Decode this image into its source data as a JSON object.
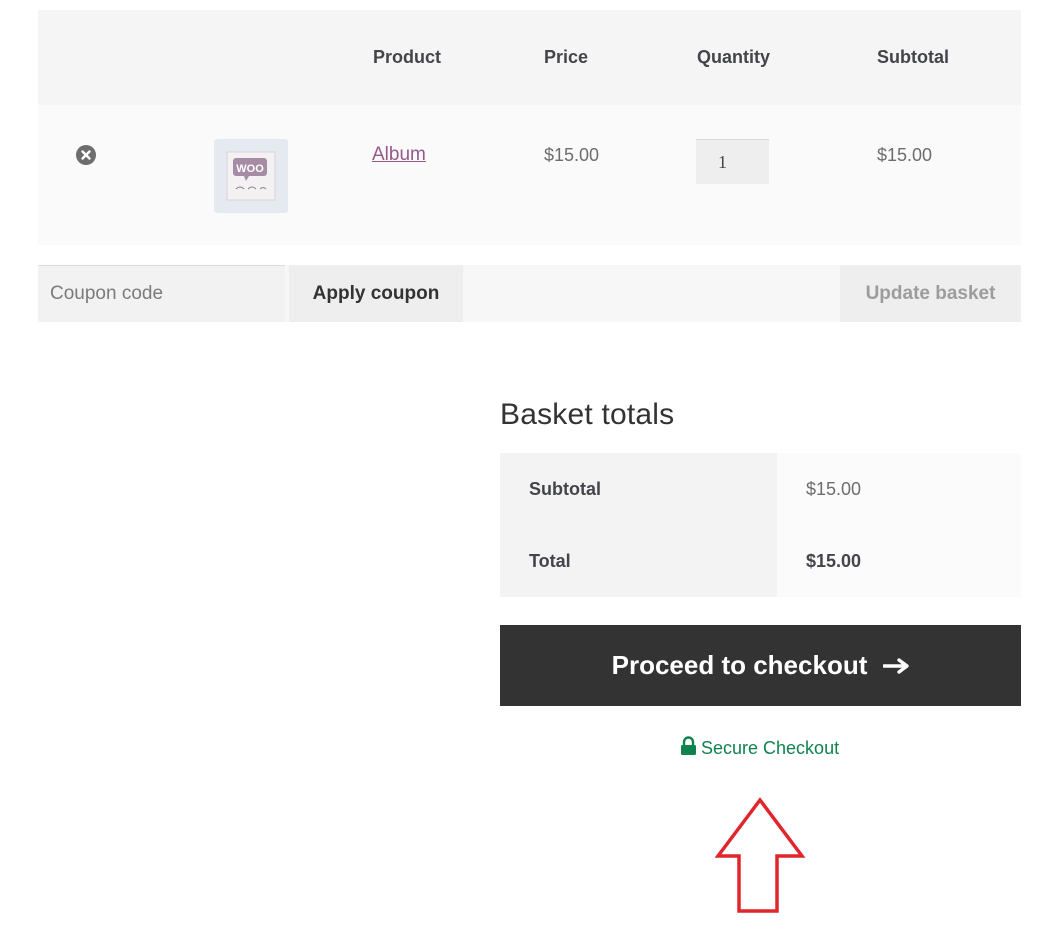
{
  "cart": {
    "headers": {
      "product": "Product",
      "price": "Price",
      "quantity": "Quantity",
      "subtotal": "Subtotal"
    },
    "items": [
      {
        "name": "Album",
        "thumbnail_text": "WOO",
        "price": "$15.00",
        "quantity": "1",
        "subtotal": "$15.00"
      }
    ]
  },
  "actions": {
    "coupon_placeholder": "Coupon code",
    "apply_coupon_label": "Apply coupon",
    "update_basket_label": "Update basket"
  },
  "totals": {
    "title": "Basket totals",
    "subtotal_label": "Subtotal",
    "subtotal_value": "$15.00",
    "total_label": "Total",
    "total_value": "$15.00"
  },
  "checkout": {
    "button_label": "Proceed to checkout",
    "secure_label": "Secure Checkout"
  },
  "colors": {
    "checkout_button": "#333333",
    "product_link": "#96588a",
    "secure_text": "#0f834d",
    "annotation_arrow": "#e0262c"
  },
  "icons": {
    "remove": "remove-icon",
    "checkout_arrow": "arrow-right-icon",
    "secure": "lock-icon",
    "annotation": "up-arrow-annotation"
  }
}
